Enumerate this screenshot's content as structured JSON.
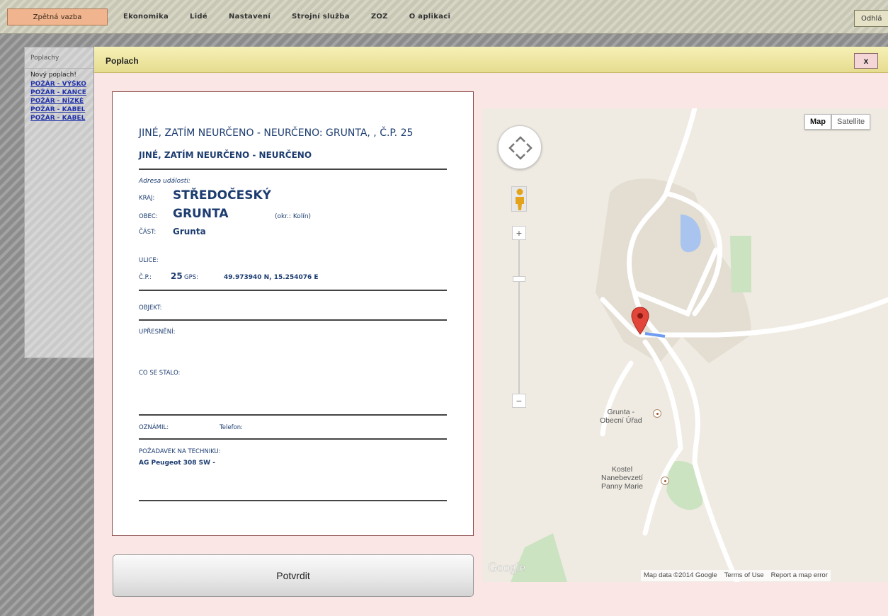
{
  "topbar": {
    "feedback_label": "Zpětná vazba",
    "menu": [
      "Ekonomika",
      "Lidé",
      "Nastavení",
      "Strojní služba",
      "ZOZ",
      "O aplikaci"
    ],
    "logout_label": "Odhlá"
  },
  "sidebar": {
    "title": "Poplachy",
    "new_alarm": "Nový poplach!",
    "items": [
      "POŽÁR - VÝŠKO",
      "POŽÁR - KANCE",
      "POŽÁR - NÍZKÉ",
      "POŽÁR - KABEL",
      "POŽÁR - KABEL"
    ]
  },
  "dialog": {
    "title": "Poplach",
    "close_label": "x",
    "event_title": "JINÉ, ZATÍM NEURČENO - NEURČENO: GRUNTA, , Č.P. 25",
    "event_type": "JINÉ, ZATÍM NEURČENO - NEURČENO",
    "address_hint": "Adresa události:",
    "kraj_label": "KRAJ:",
    "kraj_value": "STŘEDOČESKÝ",
    "obec_label": "OBEC:",
    "obec_value": "GRUNTA",
    "okres": "(okr.: Kolín)",
    "cast_label": "ČÁST:",
    "cast_value": "Grunta",
    "ulice_label": "ULICE:",
    "cp_label": "Č.P.:",
    "cp_value": "25",
    "gps_label": "GPS:",
    "gps_value": "49.973940 N, 15.254076 E",
    "objekt_label": "OBJEKT:",
    "upresneni_label": "UPŘESNĚNÍ:",
    "co_se_stalo_label": "CO SE STALO:",
    "oznamil_label": "OZNÁMIL:",
    "telefon_label": "Telefon:",
    "pozadavek_label": "POŽADAVEK NA TECHNIKU:",
    "pozadavek_value": "AG Peugeot 308 SW -",
    "confirm_label": "Potvrdit"
  },
  "map": {
    "type_map": "Map",
    "type_satellite": "Satellite",
    "zoom_in": "+",
    "zoom_out": "−",
    "place_office_1": "Grunta -",
    "place_office_2": "Obecní Úřad",
    "place_church_1": "Kostel",
    "place_church_2": "Nanebevzetí",
    "place_church_3": "Panny Marie",
    "logo": "Google",
    "attribution": "Map data ©2014 Google",
    "terms": "Terms of Use",
    "report": "Report a map error"
  }
}
